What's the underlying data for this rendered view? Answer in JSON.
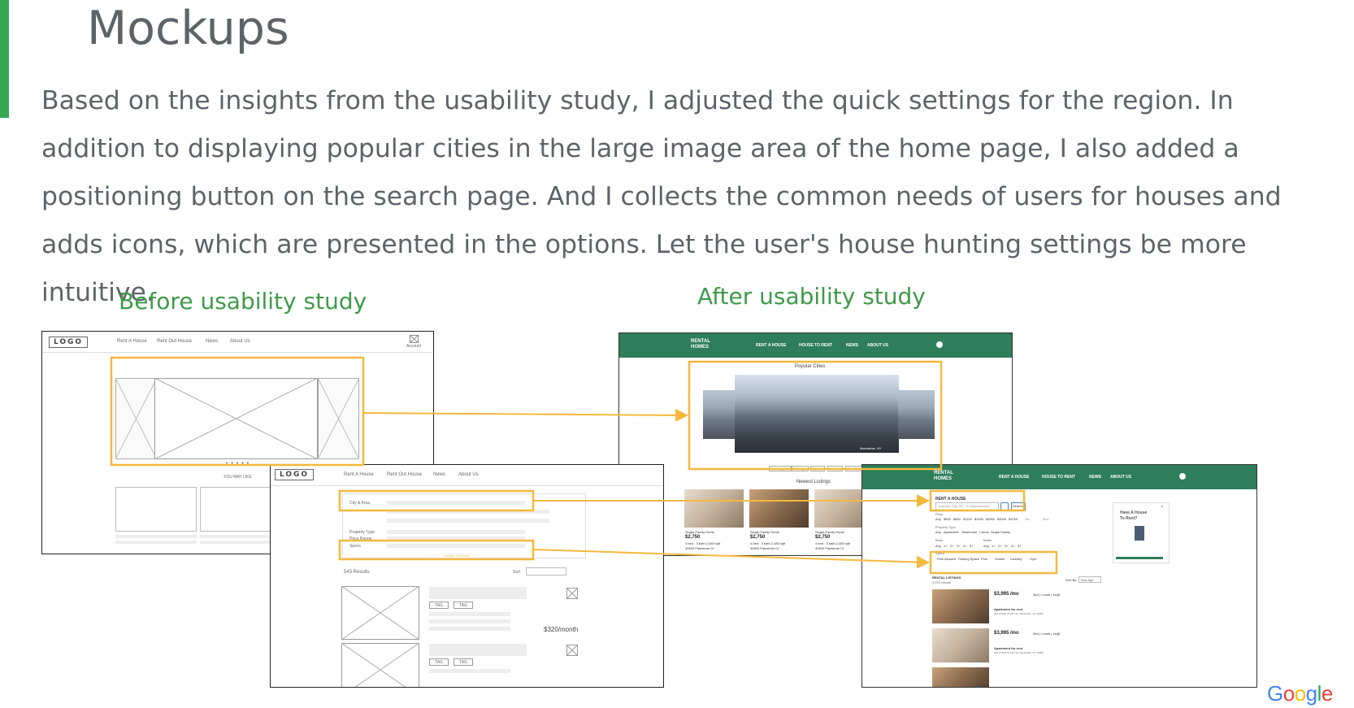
{
  "slide": {
    "title": "Mockups",
    "body": "Based on the insights from the usability study, I adjusted the quick settings for the region. In addition to displaying popular cities in the large image area of the home page, I also added a positioning button on the search page. And I collects the common needs of users for houses and adds icons, which are presented in the options. Let the user's house hunting settings be more intuitive.",
    "caption_before": "Before usability study",
    "caption_after": "After usability study",
    "accent_color": "#34a853",
    "highlight_color": "#f6b83f",
    "footer_logo": [
      "G",
      "o",
      "o",
      "g",
      "l",
      "e"
    ],
    "footer_logo_colors": [
      "#4285f4",
      "#ea4335",
      "#fbbc05",
      "#4285f4",
      "#34a853",
      "#ea4335"
    ]
  },
  "wireframe_home": {
    "logo": "LOGO",
    "nav": [
      "Rent A House",
      "Rent Out House",
      "News",
      "About Us"
    ],
    "account_label": "Account",
    "dots": "• • • • •",
    "section_label": "YOU MAY LIKE"
  },
  "wireframe_search": {
    "logo": "LOGO",
    "nav": [
      "Rent A House",
      "Rent Out House",
      "News",
      "About Us"
    ],
    "filters": [
      "City & Area",
      "Property Type",
      "Price Range",
      "Specs"
    ],
    "more_options": "MORE OPTIONS",
    "results": "543 Results",
    "sort_label": "Sort :",
    "tags": [
      "TAG",
      "TAG",
      "TAG",
      "TAG"
    ],
    "price": "$320/month"
  },
  "hifi_home": {
    "brand": [
      "RENTAL",
      "HOMES"
    ],
    "nav": [
      "RENT A HOUSE",
      "HOUSE TO RENT",
      "NEWS",
      "ABOUT US"
    ],
    "popular_title": "Popular Cities",
    "featured_city": "Manhattan, NY",
    "city_chips": [
      "Los Angeles",
      "Chicago",
      "Seattle",
      "Toronto",
      "Providence"
    ],
    "newest_title": "Newest Listings",
    "listings": [
      {
        "type": "Single-Family Home",
        "price": "$2,750",
        "specs": "4 bed · 3 bath 2,480 sqft",
        "address": "40820 Pipestone Ct"
      },
      {
        "type": "Single-Family Home",
        "price": "$2,750",
        "specs": "4 bed · 3 bath 2,480 sqft",
        "address": "40820 Pipestone Ct"
      },
      {
        "type": "Single-Family Home",
        "price": "$2,750",
        "specs": "4 bed · 3 bath 2,480 sqft",
        "address": "40820 Pipestone Ct"
      }
    ]
  },
  "hifi_search": {
    "brand": [
      "RENTAL",
      "HOMES"
    ],
    "nav": [
      "RENT A HOUSE",
      "HOUSE TO RENT",
      "NEWS",
      "ABOUT US"
    ],
    "section": "RENT A HOUSE",
    "search_placeholder": "Address, City, ZIP, or Neighborhood",
    "search_button": "Search",
    "price_label": "Price",
    "price_values": [
      "Any",
      "$500",
      "$800",
      "$1100",
      "$1500",
      "$2500",
      "$3000",
      "$3750",
      "Min",
      "Max"
    ],
    "property_label": "Property Type",
    "property_values": [
      "Any",
      "Apartment",
      "Townhome",
      "Condo",
      "Single Family"
    ],
    "beds_label": "Beds",
    "baths_label": "Baths",
    "beds_values": [
      "Any",
      "1+",
      "2+",
      "3+",
      "4+",
      "5+"
    ],
    "baths_values": [
      "Any",
      "1+",
      "2+",
      "3+",
      "4+",
      "5+"
    ],
    "specs_label": "Specs",
    "specs_values": [
      "Pets Allowed",
      "Parking Space",
      "Pool",
      "Smoke",
      "Laundry",
      "Gym"
    ],
    "listings_title": "RENTAL LISTINGS",
    "listings_count": "3,570 results",
    "sort_label": "Sort By:",
    "sort_value": "Total Age",
    "promo_line1": "Have A House",
    "promo_line2": "To Rent?",
    "promo_close": "x",
    "listings": [
      {
        "price": "$3,995 /mo",
        "specs": "2bd | 1 bath | 1sqft",
        "title": "Apartment for rent",
        "address": "300 W 94th St APT 3A, Manhattan, NY 10025"
      },
      {
        "price": "$3,995 /mo",
        "specs": "2bd | 1 bath | 1sqft",
        "title": "Apartment for rent",
        "address": "300 W 94th St APT 3A, Manhattan, NY 10025"
      }
    ]
  }
}
